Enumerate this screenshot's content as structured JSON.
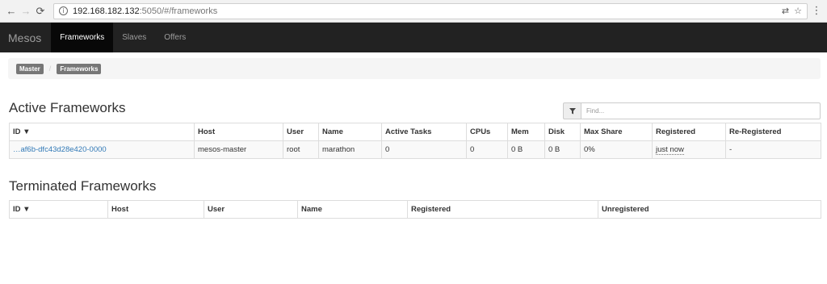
{
  "browser": {
    "url_host": "192.168.182.132",
    "url_rest": ":5050/#/frameworks",
    "back_icon": "←",
    "forward_icon": "→",
    "reload_icon": "⟳",
    "info_icon": "i",
    "translate_icon": "⇄",
    "star_icon": "☆",
    "menu_icon": "⋮"
  },
  "navbar": {
    "brand": "Mesos",
    "links": [
      "Frameworks",
      "Slaves",
      "Offers"
    ]
  },
  "breadcrumb": [
    "Master",
    "Frameworks"
  ],
  "active": {
    "title": "Active Frameworks",
    "filter_placeholder": "Find...",
    "columns": [
      "ID ▼",
      "Host",
      "User",
      "Name",
      "Active Tasks",
      "CPUs",
      "Mem",
      "Disk",
      "Max Share",
      "Registered",
      "Re-Registered"
    ],
    "rows": [
      {
        "id": "…af6b-dfc43d28e420-0000",
        "host": "mesos-master",
        "user": "root",
        "name": "marathon",
        "active_tasks": "0",
        "cpus": "0",
        "mem": "0 B",
        "disk": "0 B",
        "max_share": "0%",
        "registered": "just now",
        "reregistered": "-"
      }
    ]
  },
  "terminated": {
    "title": "Terminated Frameworks",
    "columns": [
      "ID ▼",
      "Host",
      "User",
      "Name",
      "Registered",
      "Unregistered"
    ]
  }
}
